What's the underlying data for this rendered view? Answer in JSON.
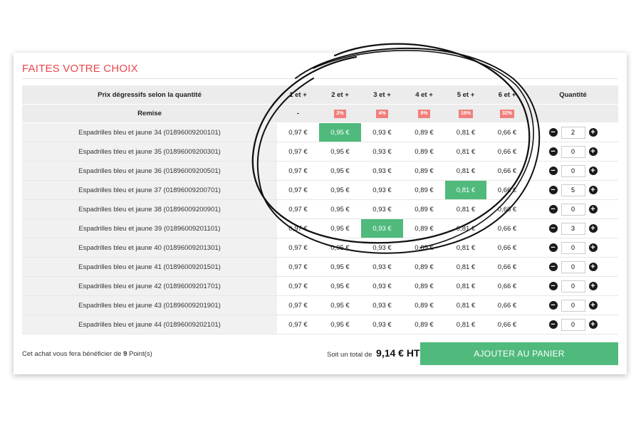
{
  "title": "FAITES VOTRE CHOIX",
  "table": {
    "header_label": "Prix dégressifs selon la quantité",
    "tiers": [
      "1 et +",
      "2 et +",
      "3 et +",
      "4 et +",
      "5 et +",
      "6 et +"
    ],
    "quantity_label": "Quantité",
    "remise_label": "Remise",
    "remises": [
      "-",
      "2%",
      "4%",
      "8%",
      "16%",
      "32%"
    ],
    "prices": [
      "0,97 €",
      "0,95 €",
      "0,93 €",
      "0,89 €",
      "0,81 €",
      "0,66 €"
    ],
    "rows": [
      {
        "name": "Espadrilles bleu et jaune 34 (01896009200101)",
        "qty": "2",
        "selected_tier": 1
      },
      {
        "name": "Espadrilles bleu et jaune 35 (01896009200301)",
        "qty": "0",
        "selected_tier": -1
      },
      {
        "name": "Espadrilles bleu et jaune 36 (01896009200501)",
        "qty": "0",
        "selected_tier": -1
      },
      {
        "name": "Espadrilles bleu et jaune 37 (01896009200701)",
        "qty": "5",
        "selected_tier": 4
      },
      {
        "name": "Espadrilles bleu et jaune 38 (01896009200901)",
        "qty": "0",
        "selected_tier": -1
      },
      {
        "name": "Espadrilles bleu et jaune 39 (01896009201101)",
        "qty": "3",
        "selected_tier": 2
      },
      {
        "name": "Espadrilles bleu et jaune 40 (01896009201301)",
        "qty": "0",
        "selected_tier": -1
      },
      {
        "name": "Espadrilles bleu et jaune 41 (01896009201501)",
        "qty": "0",
        "selected_tier": -1
      },
      {
        "name": "Espadrilles bleu et jaune 42 (01896009201701)",
        "qty": "0",
        "selected_tier": -1
      },
      {
        "name": "Espadrilles bleu et jaune 43 (01896009201901)",
        "qty": "0",
        "selected_tier": -1
      },
      {
        "name": "Espadrilles bleu et jaune 44 (01896009202101)",
        "qty": "0",
        "selected_tier": -1
      }
    ]
  },
  "footer": {
    "points_prefix": "Cet achat vous fera bénéficier de ",
    "points_value": "9",
    "points_suffix": " Point(s)",
    "total_label": "Soit un total de",
    "total_amount": "9,14 € HT",
    "cart_button": "AJOUTER AU PANIER"
  },
  "colors": {
    "accent_title": "#e8474c",
    "selected_green": "#4fba7c",
    "badge_red": "#f07f7c"
  },
  "icons": {
    "minus": "minus-circle-icon",
    "plus": "plus-circle-icon"
  }
}
